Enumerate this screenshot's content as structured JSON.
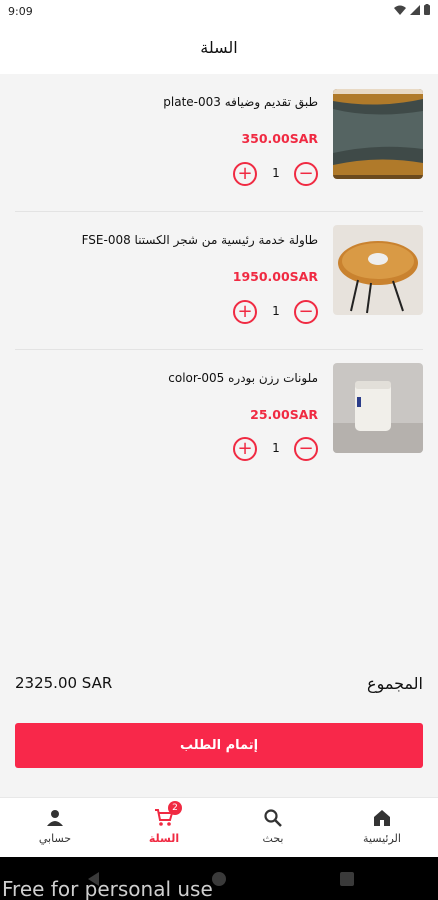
{
  "status_bar": {
    "time": "9:09"
  },
  "header": {
    "title": "السلة"
  },
  "cart": {
    "items": [
      {
        "name": "طبق تقديم وضيافه plate-003",
        "price": "350.00SAR",
        "quantity": "1"
      },
      {
        "name": "طاولة خدمة رئيسية من شجر الكستنا FSE-008",
        "price": "1950.00SAR",
        "quantity": "1"
      },
      {
        "name": "ملونات رزن بودره color-005",
        "price": "25.00SAR",
        "quantity": "1"
      }
    ],
    "total_label": "المجموع",
    "total_value": "2325.00 SAR",
    "checkout_label": "إتمام الطلب"
  },
  "bottom_nav": {
    "items": [
      {
        "label": "حسابي",
        "icon": "person-icon"
      },
      {
        "label": "السلة",
        "icon": "cart-icon",
        "badge": "2"
      },
      {
        "label": "بحث",
        "icon": "search-icon"
      },
      {
        "label": "الرئيسية",
        "icon": "home-icon"
      }
    ]
  },
  "watermark": "Free for personal use",
  "colors": {
    "accent": "#f02a42",
    "button": "#f8284a"
  }
}
